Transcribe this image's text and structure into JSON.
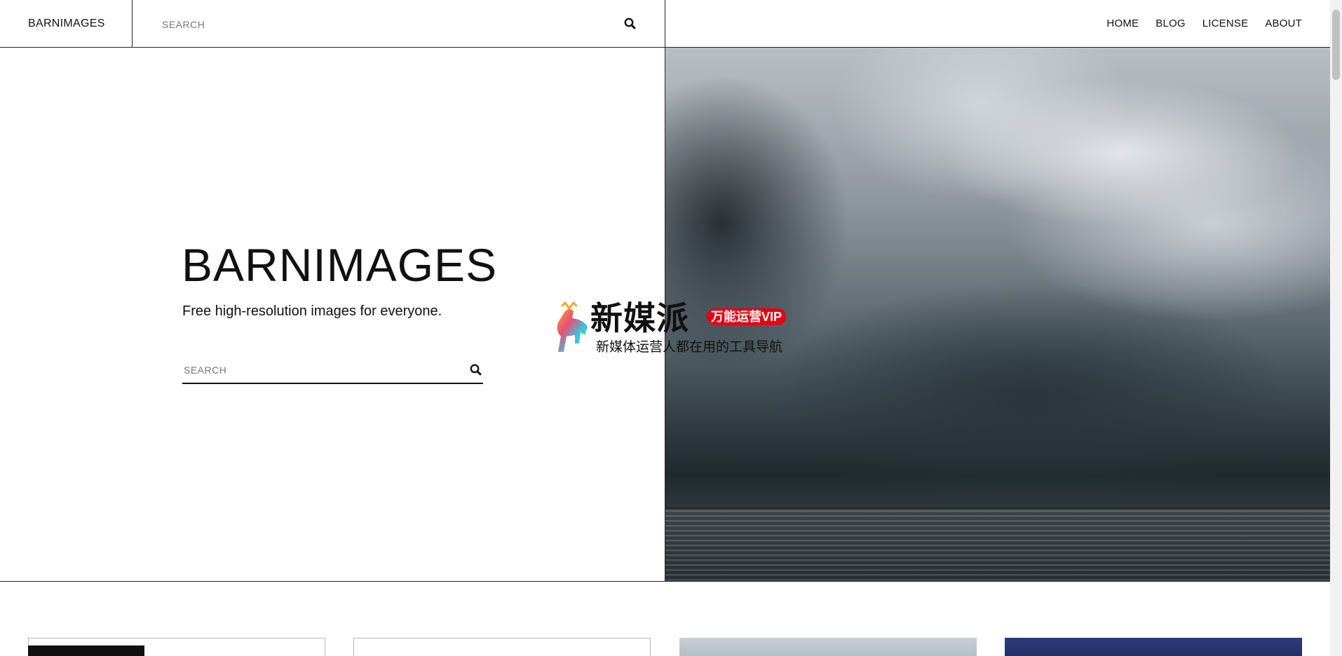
{
  "header": {
    "brand": "BARNIMAGES",
    "search_placeholder": "SEARCH",
    "nav": [
      "HOME",
      "BLOG",
      "LICENSE",
      "ABOUT"
    ]
  },
  "hero": {
    "title": "BARNIMAGES",
    "subtitle": "Free high-resolution images for everyone.",
    "search_placeholder": "SEARCH"
  },
  "watermark": {
    "title": "新媒派",
    "badge": "万能运营VIP",
    "caption": "新媒体运营人都在用的工具导航"
  },
  "icons": {
    "search": "search-icon",
    "logo": "deer-logo-icon"
  },
  "colors": {
    "border": "#222222",
    "badge": "#e60012"
  }
}
